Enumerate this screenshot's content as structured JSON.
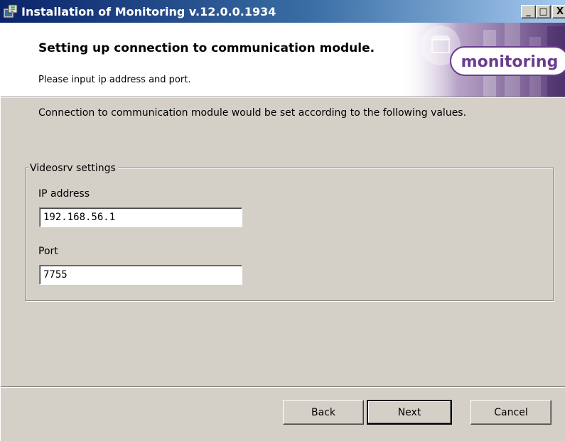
{
  "window": {
    "title": "Installation of Monitoring v.12.0.0.1934",
    "controls": {
      "minimize": "_",
      "maximize": "□",
      "close": "X"
    }
  },
  "banner": {
    "title": "Setting up connection to communication module.",
    "subtitle": "Please input ip address and port.",
    "logo_text": "monitoring"
  },
  "main": {
    "description": "Connection to communication module would be set according to the following values.",
    "group": {
      "legend": "Videosrv settings",
      "ip_label": "IP address",
      "ip_value": "192.168.56.1",
      "port_label": "Port",
      "port_value": "7755"
    }
  },
  "footer": {
    "back_label": "Back",
    "next_label": "Next",
    "cancel_label": "Cancel"
  },
  "colors": {
    "titlebar": "#0a246a",
    "face": "#d4d0c8",
    "logo_purple": "#6a3d8c"
  }
}
